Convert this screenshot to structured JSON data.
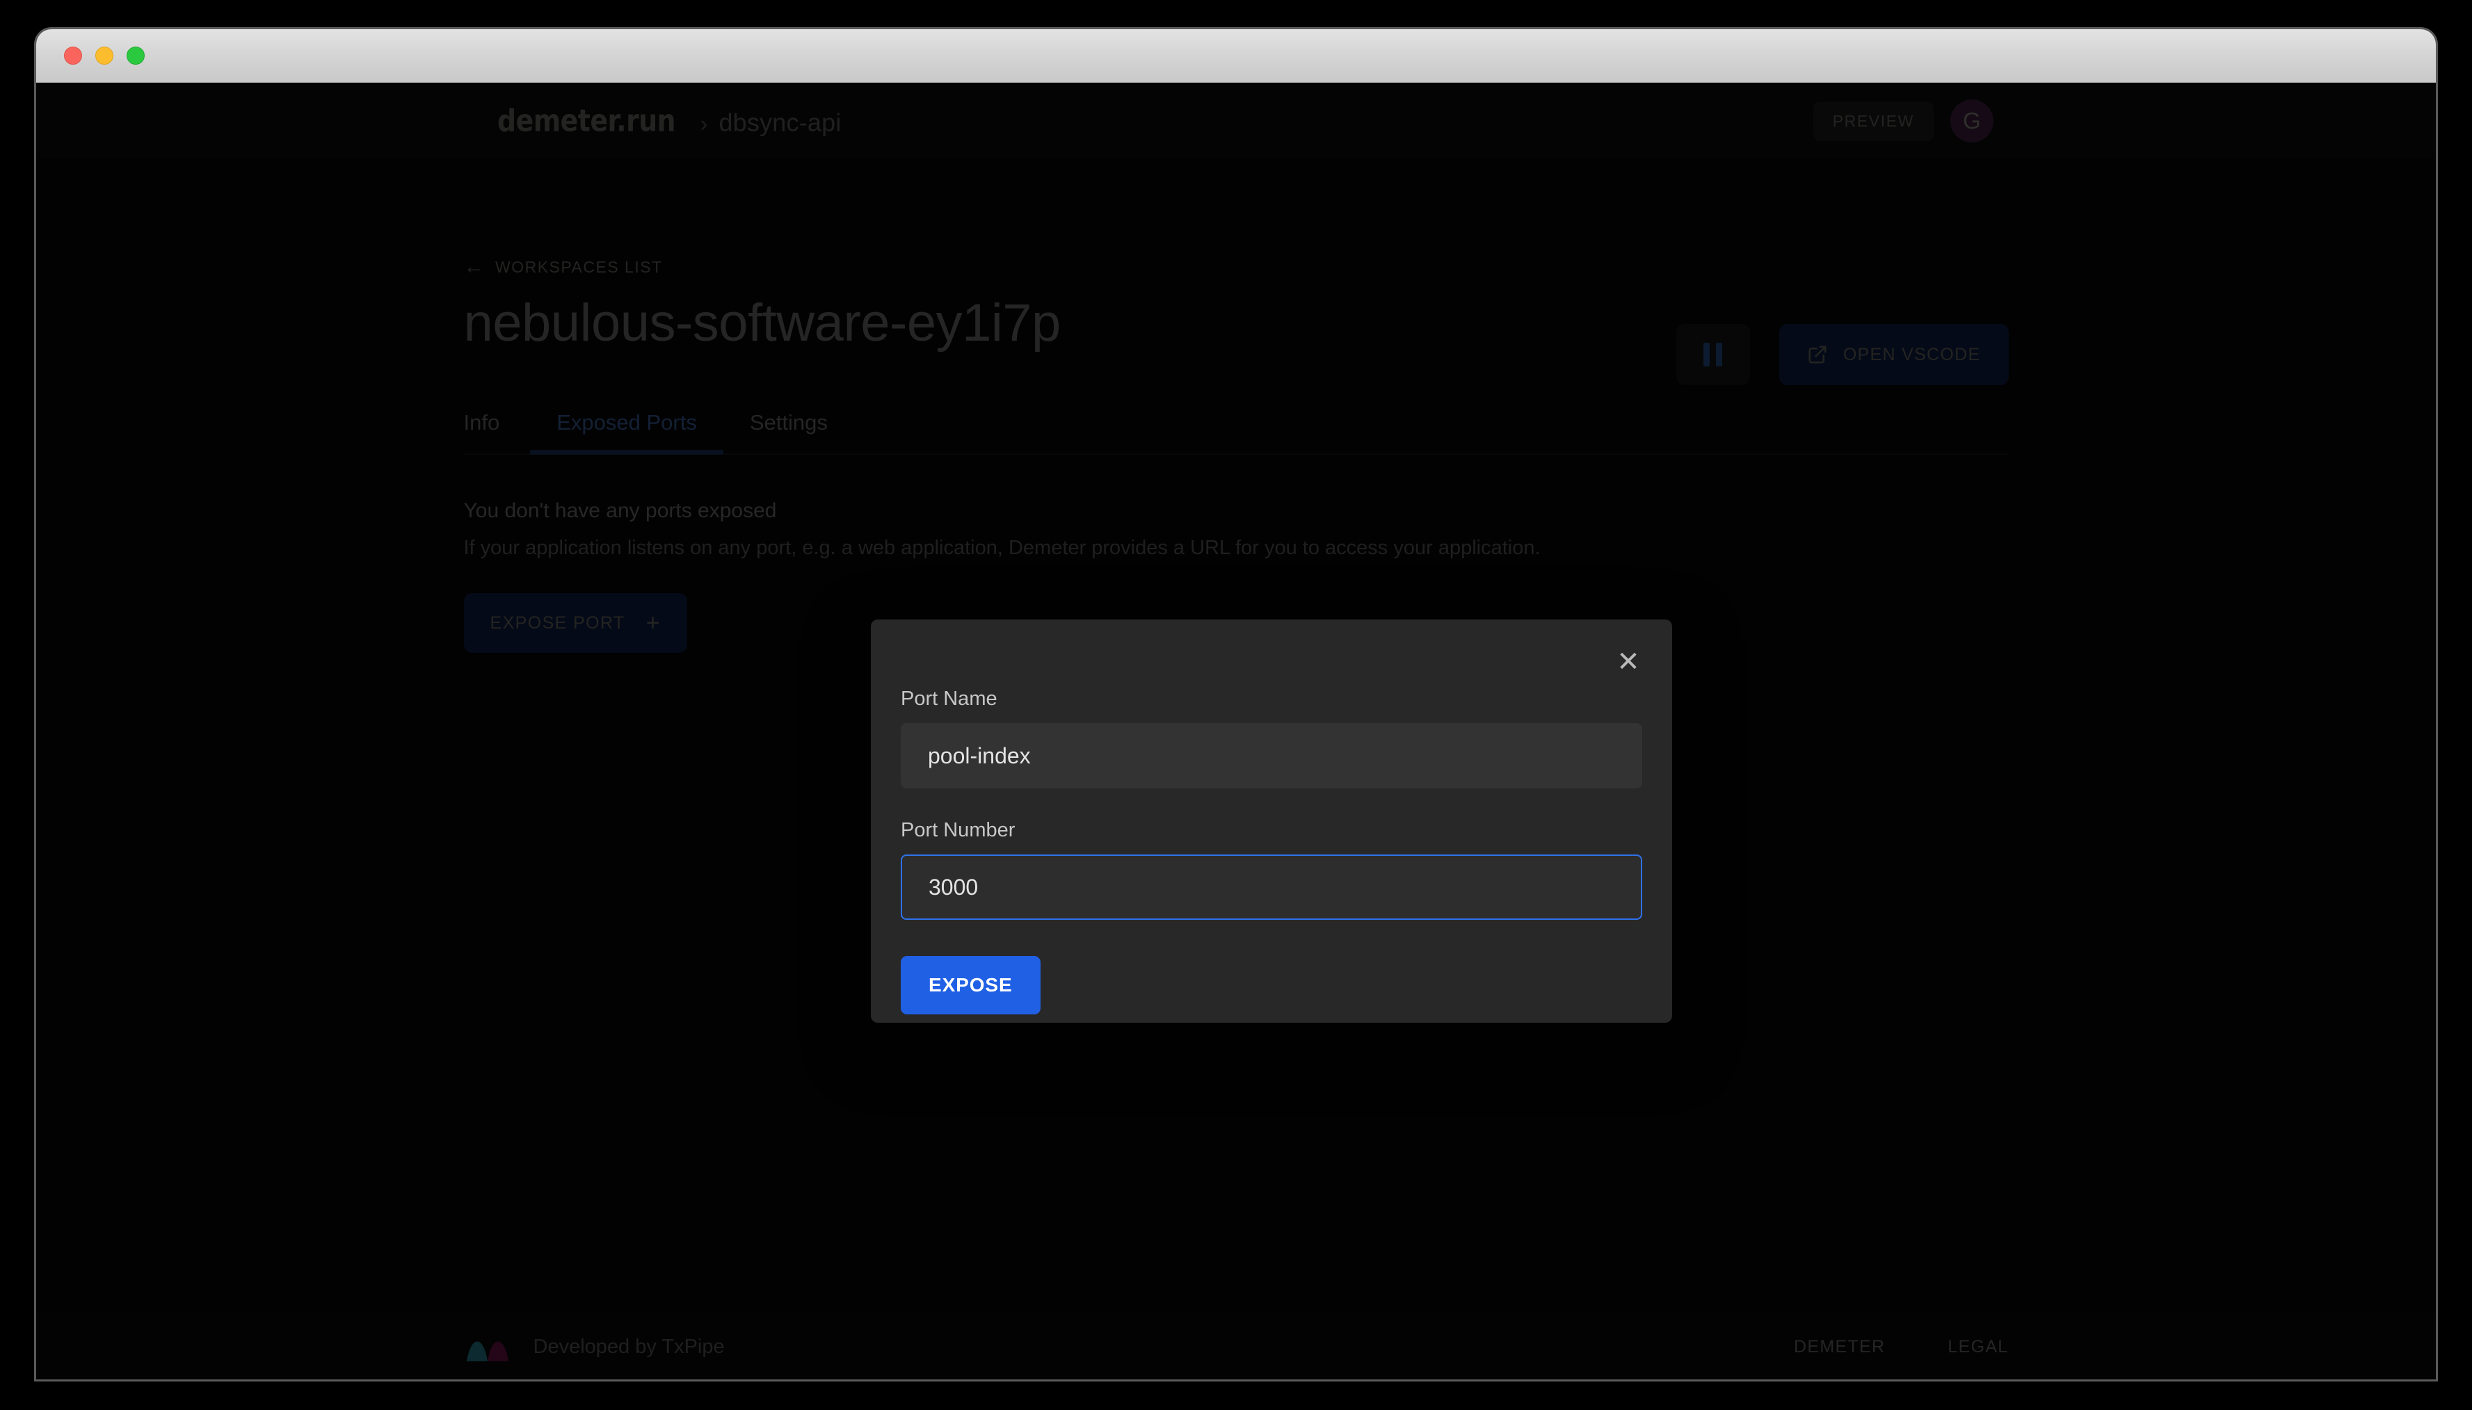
{
  "window": {
    "traffic_lights": [
      "close",
      "minimize",
      "zoom"
    ]
  },
  "header": {
    "brand": "demeter.run",
    "separator": "›",
    "project": "dbsync-api",
    "preview_badge": "PREVIEW",
    "avatar_initial": "G"
  },
  "page": {
    "back_link": "WORKSPACES LIST",
    "back_arrow": "←",
    "title": "nebulous-software-ey1i7p"
  },
  "actions": {
    "pause_label": "",
    "vscode_label": "OPEN VSCODE"
  },
  "tabs": [
    {
      "label": "Info",
      "active": false
    },
    {
      "label": "Exposed Ports",
      "active": true
    },
    {
      "label": "Settings",
      "active": false
    }
  ],
  "empty_state": {
    "title": "You don't have any ports exposed",
    "description": "If your application listens on any port, e.g. a web application, Demeter provides a URL for you to access your application.",
    "button_label": "EXPOSE PORT",
    "button_plus": "+"
  },
  "modal": {
    "close_glyph": "✕",
    "fields": [
      {
        "label": "Port Name",
        "value": "pool-index",
        "placeholder": "Port Name",
        "focused": false
      },
      {
        "label": "Port Number",
        "value": "3000",
        "placeholder": "Port Number",
        "focused": true
      }
    ],
    "submit_label": "EXPOSE"
  },
  "footer": {
    "credit": "Developed by TxPipe",
    "links": [
      "DEMETER",
      "LEGAL"
    ]
  },
  "colors": {
    "accent_blue": "#2060e5",
    "focus_blue": "#2f72ea",
    "tab_underline": "#17274a",
    "button_navy": "#0d1a3a",
    "avatar_purple": "#331a33",
    "modal_bg": "#282828",
    "page_bg": "#060606"
  }
}
